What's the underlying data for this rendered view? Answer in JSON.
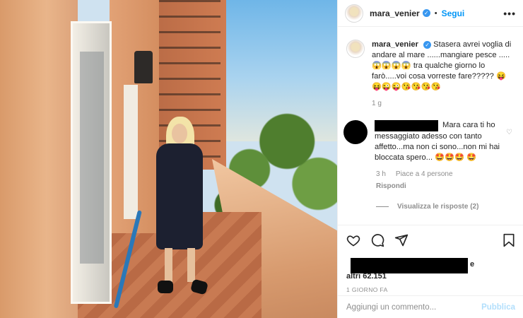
{
  "header": {
    "username": "mara_venier",
    "follow_label": "Segui",
    "separator": "•",
    "more_label": "•••"
  },
  "caption": {
    "username": "mara_venier",
    "text": "Stasera avrei voglia di andare al mare ......mangiare pesce .....😱😱😱😱 tra qualche giorno lo farò.....voi cosa vorreste fare????? 😝😝😜😜😘😘😘😘",
    "time": "1 g"
  },
  "comment": {
    "text": "Mara cara ti ho messaggiato adesso con tanto affetto...ma non ci sono...non mi hai bloccata spero... 🤩🤩🤩 🤩",
    "time": "3 h",
    "likes": "Piace a 4 persone",
    "reply_label": "Rispondi",
    "view_replies": "Visualizza le risposte (2)"
  },
  "post": {
    "likes_suffix": "e",
    "likes_count": "altri 62.151",
    "timestamp": "1 GIORNO FA"
  },
  "add_comment": {
    "placeholder": "Aggiungi un commento...",
    "publish_label": "Pubblica"
  },
  "icons": {
    "verified": "verified-badge-icon",
    "like": "heart-icon",
    "comment": "comment-icon",
    "share": "paper-plane-icon",
    "save": "bookmark-icon"
  },
  "colors": {
    "accent": "#0095f6",
    "publish_disabled": "#b2dffc",
    "meta": "#8e8e8e",
    "verified": "#3897f0"
  }
}
